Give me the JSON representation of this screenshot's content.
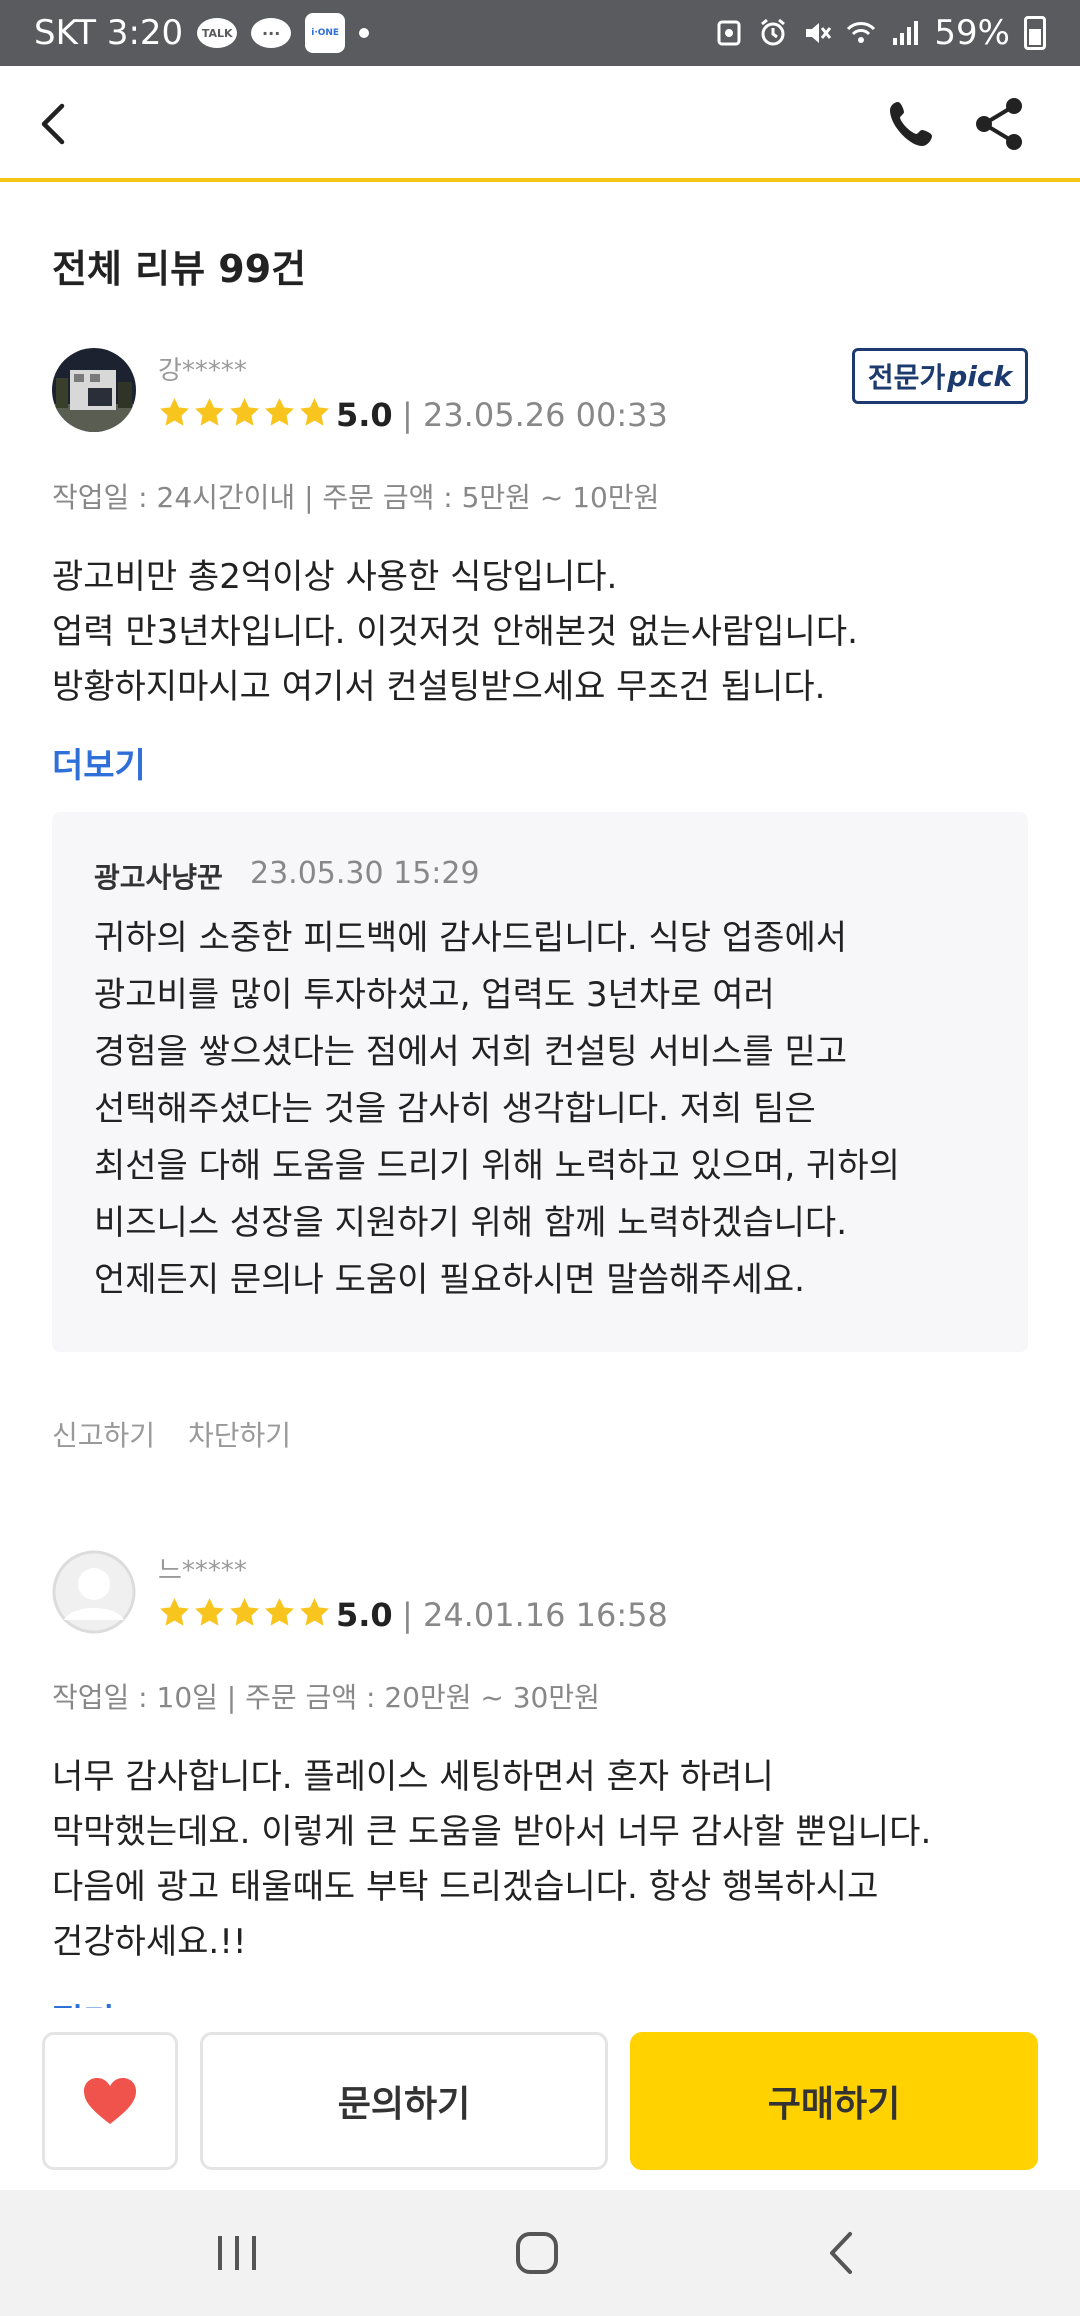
{
  "status_bar": {
    "carrier_time": "SKT 3:20",
    "talk_label": "TALK",
    "ione_label": "i·ONE",
    "battery": "59%",
    "icons": [
      "talk-icon",
      "chat-icon",
      "ione-icon",
      "screenshot-icon",
      "alarm-icon",
      "mute-icon",
      "wifi-icon",
      "signal-icon",
      "battery-icon"
    ]
  },
  "header": {
    "icons": [
      "back-icon",
      "phone-icon",
      "share-icon"
    ]
  },
  "reviews_title": "전체 리뷰 99건",
  "reviews": [
    {
      "username": "강*****",
      "rating": 5,
      "score": "5.0",
      "date": "| 23.05.26 00:33",
      "badge_main": "전문가",
      "badge_pick": "pick",
      "meta": "작업일 : 24시간이내 | 주문 금액 : 5만원 ~ 10만원",
      "text": "광고비만 총2억이상 사용한 식당입니다.\n업력 만3년차입니다. 이것저것 안해본것 없는사람입니다.\n방황하지마시고 여기서 컨설팅받으세요 무조건 됩니다.",
      "more": "더보기",
      "reply": {
        "author": "광고사냥꾼",
        "date": "23.05.30 15:29",
        "text": "귀하의 소중한 피드백에 감사드립니다. 식당 업종에서\n광고비를 많이 투자하셨고, 업력도 3년차로 여러\n경험을 쌓으셨다는 점에서 저희 컨설팅 서비스를 믿고\n선택해주셨다는 것을 감사히 생각합니다. 저희 팀은\n최선을 다해 도움을 드리기 위해 노력하고 있으며, 귀하의\n비즈니스 성장을 지원하기 위해 함께 노력하겠습니다.\n언제든지 문의나 도움이 필요하시면 말씀해주세요."
      },
      "report": "신고하기",
      "block": "차단하기"
    },
    {
      "username": "느*****",
      "rating": 5,
      "score": "5.0",
      "date": "| 24.01.16 16:58",
      "meta": "작업일 : 10일 | 주문 금액 : 20만원 ~ 30만원",
      "text": "너무 감사합니다. 플레이스 세팅하면서 혼자 하려니\n막막했는데요. 이렇게 큰 도움을 받아서 너무 감사할 뿐입니다.\n다음에 광고 태울때도 부탁 드리겠습니다. 항상 행복하시고\n건강하세요.!!",
      "more": "접기"
    }
  ],
  "action_bar": {
    "inquiry": "문의하기",
    "buy": "구매하기",
    "heart_icon": "heart-icon",
    "heart_color": "#f0524c",
    "buy_color": "#ffd200"
  },
  "nav_bar": {
    "icons": [
      "recent-apps-icon",
      "home-icon",
      "back-nav-icon"
    ]
  },
  "colors": {
    "header_accent": "#f5c518",
    "star": "#f7c51e",
    "link": "#2e6fd8",
    "badge": "#1c3a6e"
  }
}
